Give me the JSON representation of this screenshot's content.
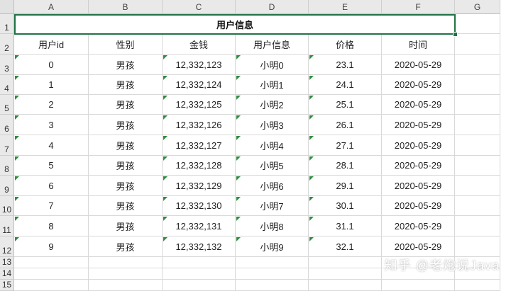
{
  "columns": [
    "A",
    "B",
    "C",
    "D",
    "E",
    "F",
    "G"
  ],
  "row_numbers": [
    "1",
    "2",
    "3",
    "4",
    "5",
    "6",
    "7",
    "8",
    "9",
    "10",
    "11",
    "12",
    "13",
    "14",
    "15"
  ],
  "title": "用户信息",
  "headers": [
    "用户id",
    "性别",
    "金钱",
    "用户信息",
    "价格",
    "时间"
  ],
  "rows": [
    [
      "0",
      "男孩",
      "12,332,123",
      "小明0",
      "23.1",
      "2020-05-29"
    ],
    [
      "1",
      "男孩",
      "12,332,124",
      "小明1",
      "24.1",
      "2020-05-29"
    ],
    [
      "2",
      "男孩",
      "12,332,125",
      "小明2",
      "25.1",
      "2020-05-29"
    ],
    [
      "3",
      "男孩",
      "12,332,126",
      "小明3",
      "26.1",
      "2020-05-29"
    ],
    [
      "4",
      "男孩",
      "12,332,127",
      "小明4",
      "27.1",
      "2020-05-29"
    ],
    [
      "5",
      "男孩",
      "12,332,128",
      "小明5",
      "28.1",
      "2020-05-29"
    ],
    [
      "6",
      "男孩",
      "12,332,129",
      "小明6",
      "29.1",
      "2020-05-29"
    ],
    [
      "7",
      "男孩",
      "12,332,130",
      "小明7",
      "30.1",
      "2020-05-29"
    ],
    [
      "8",
      "男孩",
      "12,332,131",
      "小明8",
      "31.1",
      "2020-05-29"
    ],
    [
      "9",
      "男孩",
      "12,332,132",
      "小明9",
      "32.1",
      "2020-05-29"
    ]
  ],
  "watermark": "知乎 @老炮说Java",
  "colors": {
    "selection": "#217346",
    "error_indicator": "#2e8b3e",
    "header_bg": "#e9e9e9"
  }
}
